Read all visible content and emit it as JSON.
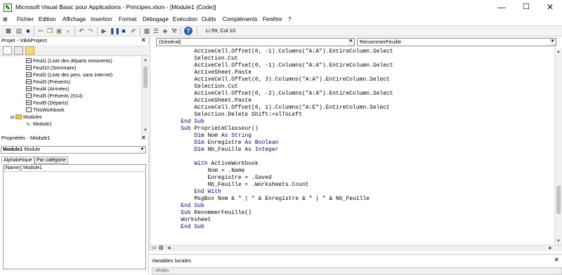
{
  "window": {
    "title": "Microsoft Visual Basic pour Applications - Principes.xlsm - [Module1 (Code)]",
    "minimize": "—",
    "restore": "☐",
    "close": "✕"
  },
  "menu": [
    "Fichier",
    "Edition",
    "Affichage",
    "Insertion",
    "Format",
    "Débogage",
    "Exécution",
    "Outils",
    "Compléments",
    "Fenêtre",
    "?"
  ],
  "toolbar": {
    "position": "Li 59, Col 10"
  },
  "project": {
    "title": "Projet - VBAProject",
    "items": [
      "Feuil1 (Liste des départs imminents)",
      "Feuil10 (Sommaire)",
      "Feuil2 (Liste des pers. sans internet)",
      "Feuil3 (Présents)",
      "Feuil4 (Arrivées)",
      "Feuil5 (Présents 2014)",
      "Feuil9 (Départs)",
      "ThisWorkbook",
      "Modules",
      "Module1"
    ]
  },
  "properties": {
    "title": "Propriétés - Module1",
    "object_name": "Module1",
    "object_type": "Module",
    "tabs": [
      "Alphabétique",
      "Par catégorie"
    ],
    "row_name": "(Name)",
    "row_value": "Module1"
  },
  "code": {
    "object_combo": "(Général)",
    "proc_combo": "RenommerFeuille",
    "lines": [
      "        ActiveCell.Offset(0, -1).Columns(\"A:A\").EntireColumn.Select",
      "        Selection.Cut",
      "        ActiveCell.Offset(0, -1).Columns(\"A:A\").EntireColumn.Select",
      "        ActiveSheet.Paste",
      "        ActiveCell.Offset(0, 3).Columns(\"A:A\").EntireColumn.Select",
      "        Selection.Cut",
      "        ActiveCell.Offset(0, -2).Columns(\"A:A\").EntireColumn.Select",
      "        ActiveSheet.Paste",
      "        ActiveCell.Offset(0, 1).Columns(\"A:E\").EntireColumn.Select",
      "        Selection.Delete Shift:=xlToLeft",
      "    End Sub",
      "    Sub ProprieteClasseur()",
      "        Dim Nom As String",
      "        Dim Enregistre As Boolean",
      "        Dim Nb_Feuille As Integer",
      "",
      "        With ActiveWorkbook",
      "            Nom = .Name",
      "            Enregistre = .Saved",
      "            Nb_Feuille = .Worksheets.Count",
      "        End With",
      "        MsgBox Nom & \" | \" & Enregistre & \" | \" & Nb_Feuille",
      "    End Sub",
      "    Sub RenommerFeuille()",
      "    Worksheet",
      "    End Sub"
    ]
  },
  "locals": {
    "title": "Variables locales",
    "placeholder": "<Prêt>"
  }
}
